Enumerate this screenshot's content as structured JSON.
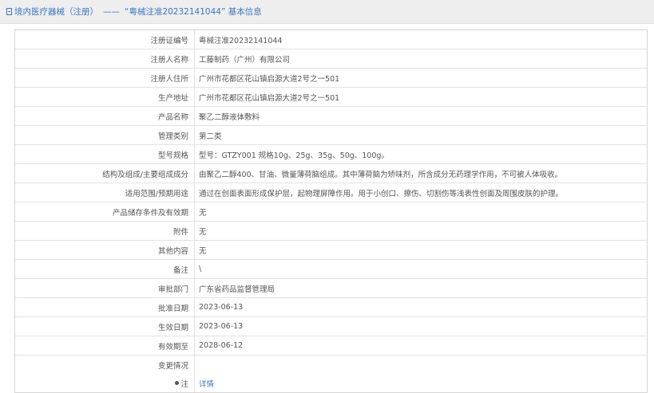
{
  "header": {
    "prefix": "境内医疗器械（注册）",
    "separator": "——",
    "suffix": "“粤械注准20232141044” 基本信息"
  },
  "rows": [
    {
      "label": "注册证编号",
      "value": "粤械注准20232141044"
    },
    {
      "label": "注册人名称",
      "value": "工藤制药（广州）有限公司"
    },
    {
      "label": "注册人住所",
      "value": "广州市花都区花山镇启源大道2号之一501"
    },
    {
      "label": "生产地址",
      "value": "广州市花都区花山镇启源大道2号之一501"
    },
    {
      "label": "产品名称",
      "value": "聚乙二醇液体敷料"
    },
    {
      "label": "管理类别",
      "value": "第二类"
    },
    {
      "label": "型号规格",
      "value": "型号：GTZY001 规格10g、25g、35g、50g、100g。"
    },
    {
      "label": "结构及组成/主要组成成分",
      "value": "由聚乙二醇400、甘油、微量薄荷脑组成。其中薄荷脑为矫味剂，所含成分无药理学作用，不可被人体吸收。"
    },
    {
      "label": "适用范围/预期用途",
      "value": "通过在创面表面形成保护层，起物理屏障作用。用于小创口、擦伤、切割伤等浅表性创面及周围皮肤的护理。"
    },
    {
      "label": "产品储存条件及有效期",
      "value": "无"
    },
    {
      "label": "附件",
      "value": "无"
    },
    {
      "label": "其他内容",
      "value": "无"
    },
    {
      "label": "备注",
      "value": "\\"
    },
    {
      "label": "审批部门",
      "value": "广东省药品监督管理局"
    },
    {
      "label": "批准日期",
      "value": "2023-06-13"
    },
    {
      "label": "生效日期",
      "value": "2023-06-13"
    },
    {
      "label": "有效期至",
      "value": "2028-06-12"
    },
    {
      "label": "变更情况",
      "value": ""
    }
  ],
  "note": {
    "label": "注",
    "link": "详情"
  }
}
